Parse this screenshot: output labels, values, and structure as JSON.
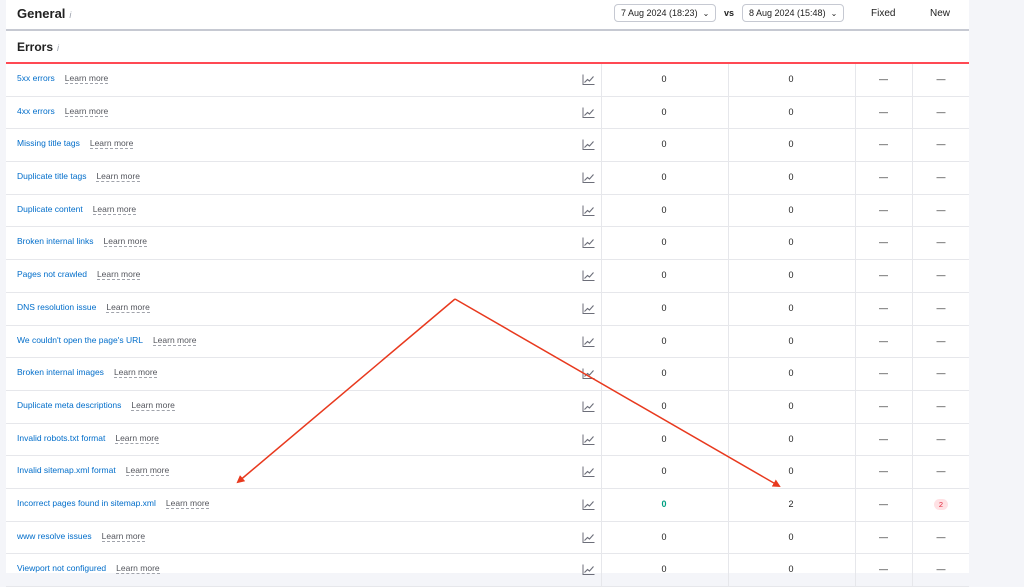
{
  "header": {
    "title": "General",
    "info_mark": "i",
    "date_left": "7 Aug 2024 (18:23)",
    "vs": "vs",
    "date_right": "8 Aug 2024 (15:48)",
    "col_fixed": "Fixed",
    "col_new": "New"
  },
  "section": {
    "title": "Errors",
    "info_mark": "i",
    "learn_label": "Learn more"
  },
  "rows": [
    {
      "name": "5xx errors",
      "left": "0",
      "right": "0",
      "fixed": "—",
      "new": "—"
    },
    {
      "name": "4xx errors",
      "left": "0",
      "right": "0",
      "fixed": "—",
      "new": "—"
    },
    {
      "name": "Missing title tags",
      "left": "0",
      "right": "0",
      "fixed": "—",
      "new": "—"
    },
    {
      "name": "Duplicate title tags",
      "left": "0",
      "right": "0",
      "fixed": "—",
      "new": "—"
    },
    {
      "name": "Duplicate content",
      "left": "0",
      "right": "0",
      "fixed": "—",
      "new": "—"
    },
    {
      "name": "Broken internal links",
      "left": "0",
      "right": "0",
      "fixed": "—",
      "new": "—"
    },
    {
      "name": "Pages not crawled",
      "left": "0",
      "right": "0",
      "fixed": "—",
      "new": "—"
    },
    {
      "name": "DNS resolution issue",
      "left": "0",
      "right": "0",
      "fixed": "—",
      "new": "—"
    },
    {
      "name": "We couldn't open the page's URL",
      "left": "0",
      "right": "0",
      "fixed": "—",
      "new": "—"
    },
    {
      "name": "Broken internal images",
      "left": "0",
      "right": "0",
      "fixed": "—",
      "new": "—"
    },
    {
      "name": "Duplicate meta descriptions",
      "left": "0",
      "right": "0",
      "fixed": "—",
      "new": "—"
    },
    {
      "name": "Invalid robots.txt format",
      "left": "0",
      "right": "0",
      "fixed": "—",
      "new": "—"
    },
    {
      "name": "Invalid sitemap.xml format",
      "left": "0",
      "right": "0",
      "fixed": "—",
      "new": "—"
    },
    {
      "name": "Incorrect pages found in sitemap.xml",
      "left": "0",
      "right": "2",
      "fixed": "—",
      "new": "2",
      "left_highlight": true,
      "new_badge": true
    },
    {
      "name": "www resolve issues",
      "left": "0",
      "right": "0",
      "fixed": "—",
      "new": "—"
    },
    {
      "name": "Viewport not configured",
      "left": "0",
      "right": "0",
      "fixed": "—",
      "new": "—"
    }
  ],
  "colors": {
    "link": "#006dca",
    "accent_red": "#ff4953",
    "arrow": "#e8391e",
    "green": "#009f81"
  },
  "icons": {
    "trend": "trend-chart-icon",
    "chevron": "chevron-down-icon",
    "info": "info-icon"
  }
}
